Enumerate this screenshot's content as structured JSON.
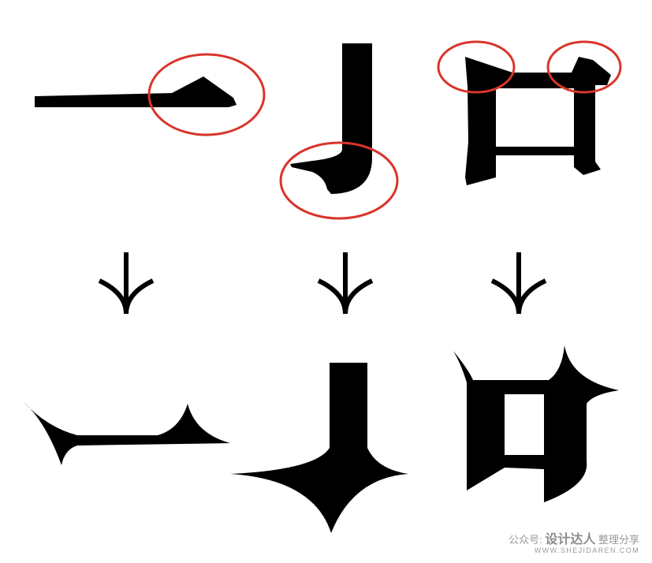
{
  "colors": {
    "glyph": "#000000",
    "highlight_circle": "#d9352b",
    "background": "#ffffff",
    "watermark": "#9a9a9a"
  },
  "rows": {
    "top": [
      "horizontal-stroke-original",
      "hook-stroke-original",
      "mouth-glyph-original"
    ],
    "bottom": [
      "horizontal-stroke-redesigned",
      "hook-stroke-redesigned",
      "mouth-glyph-redesigned"
    ]
  },
  "watermark": {
    "prefix": "公众号:",
    "brand": "设计达人",
    "suffix": "整理分享",
    "domain": "WWW.SHEJIDAREN.COM"
  }
}
